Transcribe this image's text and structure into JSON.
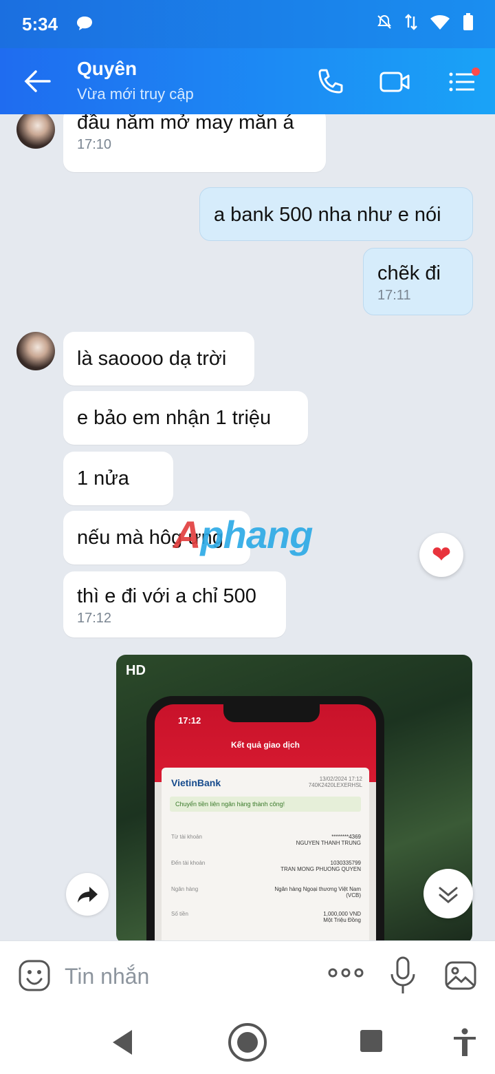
{
  "status_bar": {
    "time": "5:34",
    "icons": [
      "messenger-icon",
      "mute-icon",
      "data-icon",
      "wifi-icon",
      "battery-icon"
    ]
  },
  "header": {
    "name": "Quyên",
    "status": "Vừa mới truy cập",
    "icons": [
      "back-arrow-icon",
      "phone-icon",
      "video-icon",
      "menu-icon"
    ]
  },
  "messages": [
    {
      "text": "đầu năm mở may mắn á",
      "time": "17:10"
    },
    {
      "text": "a bank 500 nha như e nói",
      "time": ""
    },
    {
      "text": "chẽk đi",
      "time": "17:11"
    },
    {
      "text": "là saoooo dạ trời",
      "time": ""
    },
    {
      "text": "e bảo em nhận 1 triệu",
      "time": ""
    },
    {
      "text": "1 nửa",
      "time": ""
    },
    {
      "text": "nếu mà hôg ưng",
      "time": ""
    },
    {
      "text": "thì e đi với a chỉ 500",
      "time": "17:12"
    }
  ],
  "watermark": {
    "prefix": "A",
    "text": "phang"
  },
  "reaction": "❤",
  "photo": {
    "badge": "HD",
    "phone_time": "17:12",
    "screen_title": "Kết quả giao dịch",
    "bank": "VietinBank",
    "date": "13/02/2024 17:12",
    "ref": "740K2420LEXERHSL",
    "success": "Chuyển tiền liên ngân hàng thành công!",
    "rows": [
      {
        "label": "Từ tài khoản",
        "value": "********4369",
        "value2": "NGUYEN THANH TRUNG"
      },
      {
        "label": "Đến tài khoản",
        "value": "1030335799",
        "value2": "TRAN MONG PHUONG QUYEN"
      },
      {
        "label": "Ngân hàng",
        "value": "Ngân hàng Ngoại thương Việt Nam",
        "value2": "(VCB)"
      },
      {
        "label": "Số tiền",
        "value": "1,000,000 VND",
        "value2": "Một Triệu Đồng"
      }
    ]
  },
  "input": {
    "placeholder": "Tin nhắn"
  },
  "colors": {
    "accent": "#1a8ef0",
    "outgoing": "#d6ecfb",
    "background": "#e5e9ef"
  }
}
